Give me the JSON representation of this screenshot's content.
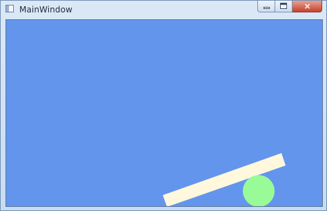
{
  "window": {
    "title": "MainWindow",
    "app_icon": "window-app-icon",
    "caption_buttons": {
      "minimize_icon": "minimize-icon",
      "maximize_icon": "maximize-icon",
      "close_label": "×"
    }
  },
  "canvas": {
    "background": "#6495ed",
    "plank_color": "#fff8dc",
    "ball_color": "#98fb98"
  }
}
